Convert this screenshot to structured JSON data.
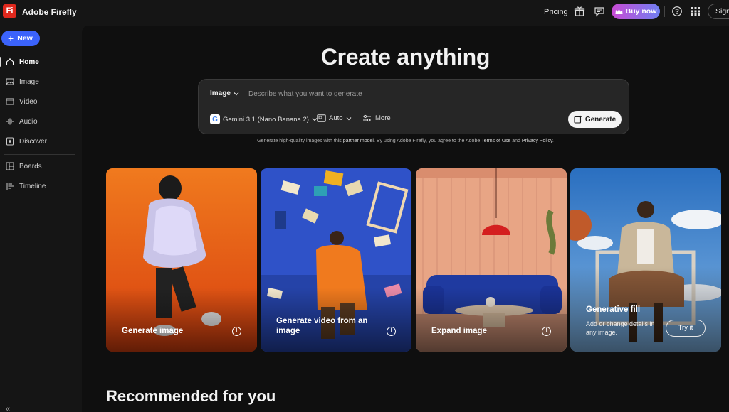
{
  "app": {
    "logo_text": "Fi",
    "name": "Adobe Firefly"
  },
  "topbar": {
    "pricing": "Pricing",
    "buy_now": "Buy now",
    "sign_in": "Sign in",
    "icons": [
      "gift-icon",
      "feedback-icon",
      "crown-icon",
      "help-icon",
      "apps-grid-icon"
    ]
  },
  "sidebar": {
    "new_label": "New",
    "items": [
      {
        "label": "Home",
        "icon": "home-icon",
        "active": true
      },
      {
        "label": "Image",
        "icon": "image-icon"
      },
      {
        "label": "Video",
        "icon": "video-icon"
      },
      {
        "label": "Audio",
        "icon": "audio-icon"
      },
      {
        "label": "Discover",
        "icon": "discover-icon"
      },
      {
        "label": "Boards",
        "icon": "boards-icon"
      },
      {
        "label": "Timeline",
        "icon": "timeline-icon"
      }
    ],
    "collapse_glyph": "«"
  },
  "hero": {
    "title": "Create anything"
  },
  "prompt": {
    "mode": "Image",
    "placeholder": "Describe what you want to generate",
    "model": "Gemini 3.1 (Nano Banana 2)",
    "ratio": "Auto",
    "more": "More",
    "generate": "Generate"
  },
  "disclaimer": {
    "part1": "Generate high-quality images with this ",
    "partner_link": "partner model",
    "part2": ". By using Adobe Firefly, you agree to the Adobe ",
    "terms_link": "Terms of Use",
    "part3": " and ",
    "privacy_link": "Privacy Policy",
    "part4": "."
  },
  "cards": [
    {
      "title": "Generate image"
    },
    {
      "title": "Generate video from an image"
    },
    {
      "title": "Expand image"
    },
    {
      "title": "Generative fill",
      "description": "Add or change details in any image.",
      "button": "Try it"
    }
  ],
  "recommended": {
    "heading": "Recommended for you"
  },
  "colors": {
    "accent": "#3b63fb",
    "buy_gradient_start": "#c94bd4",
    "buy_gradient_end": "#6f7ff2",
    "logo_red": "#e0281d"
  }
}
